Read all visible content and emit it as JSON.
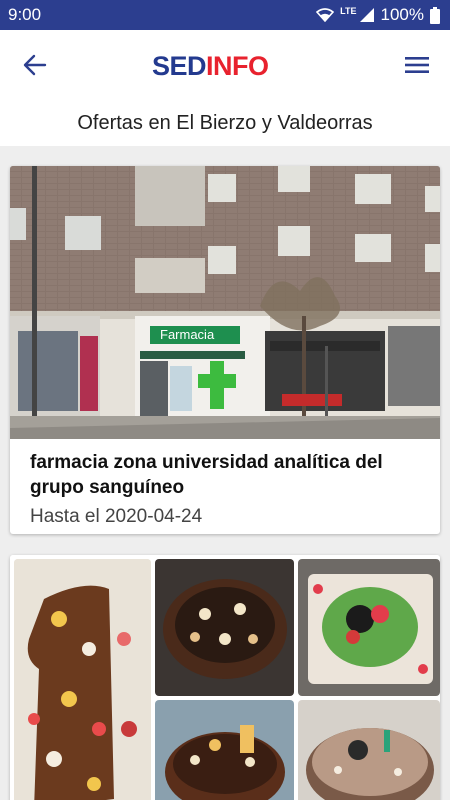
{
  "status_bar": {
    "time": "9:00",
    "network": "LTE",
    "battery": "100%",
    "icons": [
      "wifi-icon",
      "signal-icon",
      "battery-icon"
    ]
  },
  "header": {
    "logo_part1": "SED",
    "logo_part2": "INFO",
    "back_icon": "arrow-left-icon",
    "menu_icon": "hamburger-menu-icon"
  },
  "page": {
    "subtitle": "Ofertas en El Bierzo y Valdeorras"
  },
  "offers": [
    {
      "title": "farmacia zona universidad analítica del grupo sanguíneo",
      "date": "Hasta el 2020-04-24",
      "image_sign": "Farmacia"
    },
    {
      "title": "",
      "date": ""
    }
  ],
  "colors": {
    "status_bar": "#2c3e8f",
    "logo_blue": "#233a8f",
    "logo_red": "#e8222e",
    "background": "#eeeeee"
  }
}
